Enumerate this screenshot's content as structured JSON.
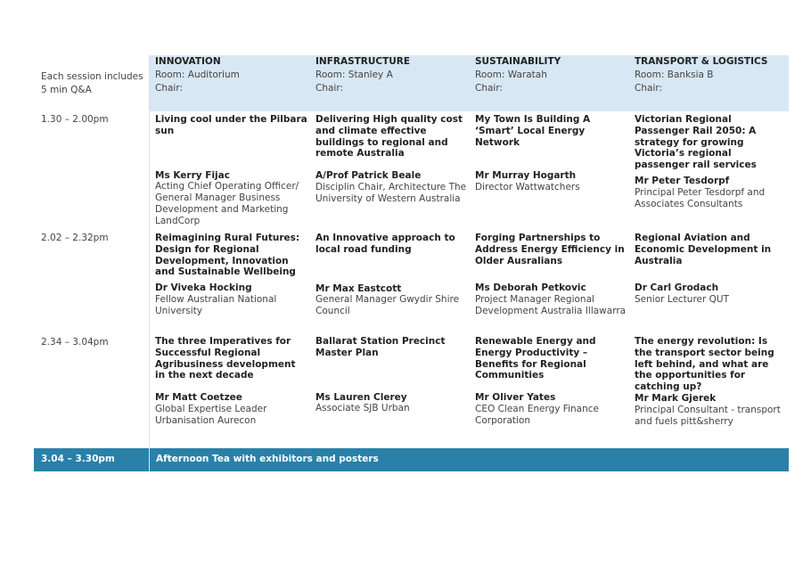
{
  "note": "Each session includes 5 min Q&A",
  "streams": [
    {
      "name": "INNOVATION",
      "room": "Room: Auditorium",
      "chair": "Chair:"
    },
    {
      "name": "INFRASTRUCTURE",
      "room": "Room: Stanley A",
      "chair": "Chair:"
    },
    {
      "name": "SUSTAINABILITY",
      "room": "Room: Waratah",
      "chair": "Chair:"
    },
    {
      "name": "TRANSPORT & LOGISTICS",
      "room": "Room: Banksia B",
      "chair": "Chair:"
    }
  ],
  "sessions": [
    {
      "time": "1.30  – 2.00pm",
      "cells": [
        {
          "title": "Living cool under the Pilbara sun",
          "speaker": "Ms Kerry Fijac",
          "details": "Acting Chief Operating Officer/ General Manager Business Development and Marketing LandCorp"
        },
        {
          "title": "Delivering High quality cost and climate effective buildings to regional and remote Australia",
          "speaker": "A/Prof Patrick Beale",
          "details": "Disciplin Chair, Architecture The University of Western Australia"
        },
        {
          "title": "My Town Is Building A ‘Smart’ Local Energy Network",
          "speaker": "Mr Murray Hogarth",
          "details": "Director Wattwatchers"
        },
        {
          "title": "Victorian Regional Passenger Rail 2050: A strategy for growing Victoria’s regional passenger rail services",
          "speaker": "Mr Peter Tesdorpf",
          "details": "Principal Peter Tesdorpf and Associates Consultants"
        }
      ]
    },
    {
      "time": "2.02  – 2.32pm",
      "cells": [
        {
          "title": "Reimagining Rural Futures: Design for Regional Development, Innovation and Sustainable Wellbeing",
          "speaker": "Dr Viveka Hocking",
          "details": "Fellow Australian National University"
        },
        {
          "title": "An Innovative approach to local road funding",
          "speaker": "Mr Max Eastcott",
          "details": "General Manager Gwydir Shire Council"
        },
        {
          "title": "Forging Partnerships to Address Energy Efficiency in Older Ausralians",
          "speaker": "Ms Deborah Petkovic",
          "details": "Project Manager Regional Development Australia Illawarra"
        },
        {
          "title": "Regional Aviation and Economic Development in Australia",
          "speaker": "Dr Carl Grodach",
          "details": "Senior  Lecturer QUT"
        }
      ]
    },
    {
      "time": "2.34  – 3.04pm",
      "cells": [
        {
          "title": "The three Imperatives for Successful Regional Agribusiness development in the next decade",
          "speaker": "Mr Matt Coetzee",
          "details": "Global Expertise Leader Urbanisation Aurecon"
        },
        {
          "title": "Ballarat Station Precinct Master Plan",
          "speaker": "Ms Lauren Clerey",
          "details": "Associate SJB Urban"
        },
        {
          "title": "Renewable Energy and Energy Productivity – Benefits for Regional Communities",
          "speaker": "Mr Oliver Yates",
          "details": "CEO Clean Energy Finance Corporation"
        },
        {
          "title": "The energy revolution: Is the transport sector being left behind, and what are the opportunities for catching up?",
          "speaker": "Mr Mark Gjerek",
          "details": "Principal Consultant - transport and fuels pitt&sherry"
        }
      ]
    }
  ],
  "break": {
    "time": "3.04  – 3.30pm",
    "label": "Afternoon Tea with exhibitors and posters"
  },
  "colors": {
    "header_band": "#d7e7f4",
    "break_bar": "#2a80a8"
  }
}
